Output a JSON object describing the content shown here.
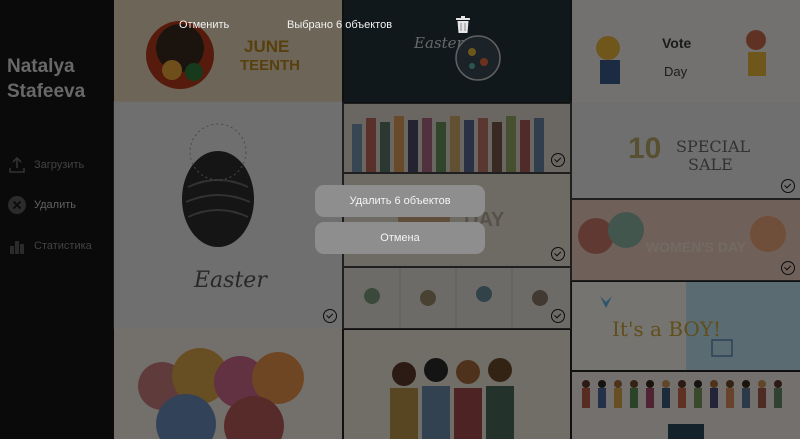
{
  "sidebar": {
    "author": "Natalya Stafeeva",
    "items": [
      {
        "label": "Загрузить",
        "icon": "upload-icon"
      },
      {
        "label": "Удалить",
        "icon": "delete-circle-icon"
      },
      {
        "label": "Статистика",
        "icon": "stats-icon"
      }
    ]
  },
  "topbar": {
    "cancel_label": "Отменить",
    "selected_label": "Выбрано 6 объектов",
    "trash_icon": "trash-icon"
  },
  "dialog": {
    "delete_label": "Удалить 6 объектов",
    "cancel_label": "Отмена"
  },
  "tiles": {
    "juneteenth_text": "JUNE TEENTH",
    "easter_small": "Easter",
    "vote_text": "Vote Day",
    "easter_big": "Easter",
    "special_sale": "SPECIAL SALE",
    "womens_day": "WOMEN'S DAY",
    "its_a_boy": "It's a BOY!"
  },
  "colors": {
    "sidebar_bg": "#151515",
    "dialog_button": "#8e8e8e",
    "overlay": "rgba(0,0,0,0.52)"
  }
}
